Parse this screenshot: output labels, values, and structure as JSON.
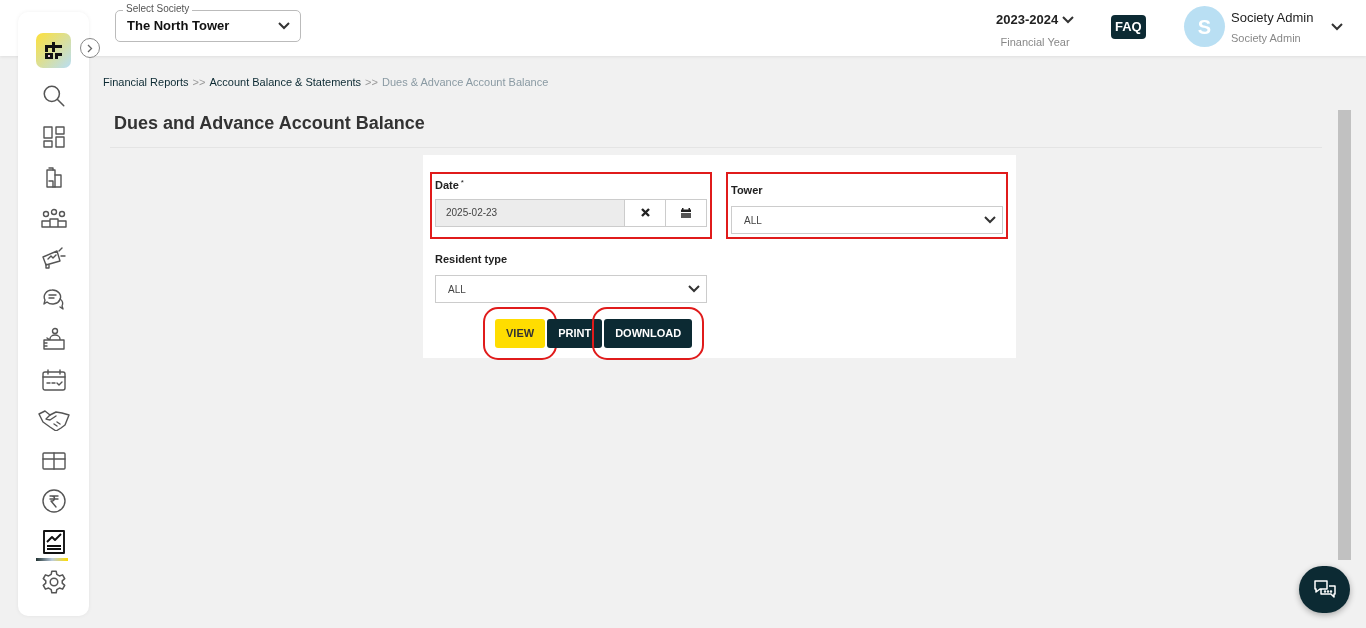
{
  "header": {
    "society_select": {
      "label": "Select Society",
      "value": "The North Tower"
    },
    "financial_year": {
      "value": "2023-2024",
      "caption": "Financial Year"
    },
    "faq": "FAQ",
    "user": {
      "avatar_letter": "S",
      "name": "Society Admin",
      "role": "Society Admin"
    }
  },
  "sidebar": {
    "items": [
      {
        "selected": false
      },
      {
        "selected": false
      },
      {
        "selected": false
      },
      {
        "selected": false
      },
      {
        "selected": false
      },
      {
        "selected": false
      },
      {
        "selected": false
      },
      {
        "selected": false
      },
      {
        "selected": false
      },
      {
        "selected": false
      },
      {
        "selected": false
      },
      {
        "selected": true
      },
      {
        "selected": false
      }
    ]
  },
  "breadcrumb": [
    {
      "text": "Financial Reports",
      "current": false
    },
    {
      "text": "Account Balance & Statements",
      "current": false
    },
    {
      "text": "Dues & Advance Account Balance",
      "current": true
    }
  ],
  "breadcrumb_separator": ">>",
  "page_title": "Dues and Advance Account Balance",
  "form": {
    "date": {
      "label": "Date",
      "required_mark": "*",
      "value": "2025-02-23",
      "highlighted": true
    },
    "tower": {
      "label": "Tower",
      "value": "ALL",
      "highlighted": true
    },
    "resident_type": {
      "label": "Resident type",
      "value": "ALL"
    },
    "buttons": [
      {
        "label": "VIEW",
        "kind": "primary",
        "highlighted": true
      },
      {
        "label": "PRINT",
        "kind": "dark",
        "highlighted": false
      },
      {
        "label": "DOWNLOAD",
        "kind": "dark",
        "highlighted": true
      }
    ]
  }
}
